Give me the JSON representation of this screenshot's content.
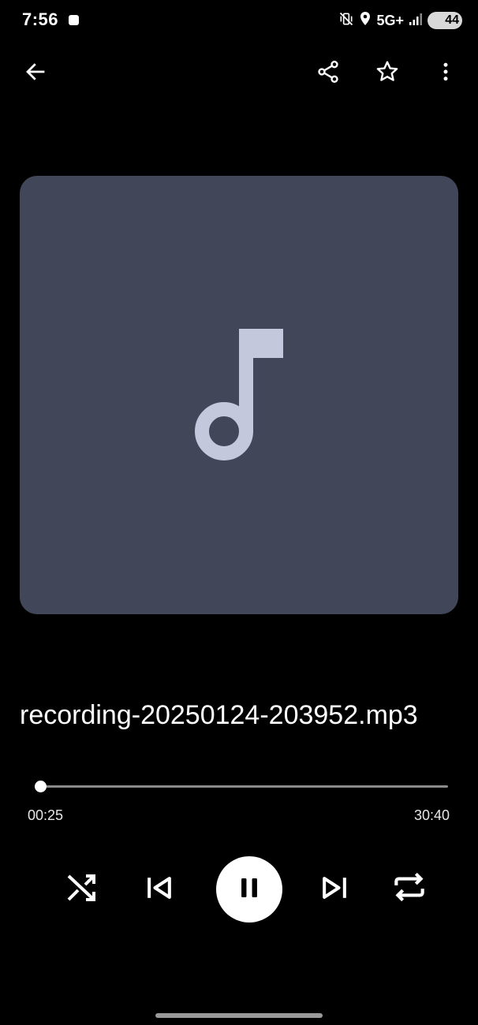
{
  "status_bar": {
    "time": "7:56",
    "network": "5G+",
    "battery": "44"
  },
  "track": {
    "title": "recording-20250124-203952.mp3",
    "elapsed": "00:25",
    "duration": "30:40",
    "progress_fraction": 0.0136
  },
  "icons": {
    "back": "arrow-left-icon",
    "share": "share-icon",
    "favorite": "star-outline-icon",
    "more": "more-vert-icon",
    "artwork": "music-note-icon",
    "shuffle": "shuffle-icon",
    "previous": "skip-previous-icon",
    "play_pause": "pause-icon",
    "next": "skip-next-icon",
    "repeat": "repeat-icon"
  },
  "colors": {
    "background": "#000000",
    "artwork_bg": "#414758",
    "artwork_note": "#c3c8dc",
    "accent": "#ffffff",
    "track": "#8a8a8a"
  }
}
